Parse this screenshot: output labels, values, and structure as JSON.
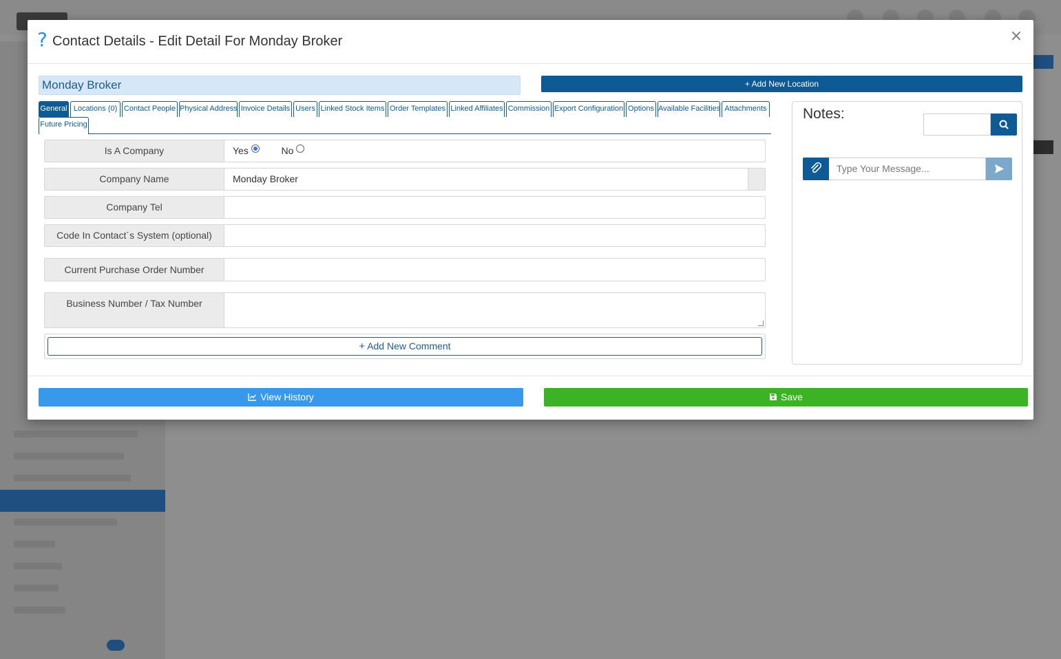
{
  "modal": {
    "title": "Contact Details - Edit Detail For Monday Broker",
    "help_icon": "?",
    "close_icon": "×"
  },
  "contact_name": "Monday Broker",
  "add_location_label": "+ Add New Location",
  "tabs": [
    {
      "label": "General",
      "active": true
    },
    {
      "label": "Locations (0)"
    },
    {
      "label": "Contact People"
    },
    {
      "label": "Physical Address"
    },
    {
      "label": "Invoice Details"
    },
    {
      "label": "Users"
    },
    {
      "label": "Linked Stock Items"
    },
    {
      "label": "Order Templates"
    },
    {
      "label": "Linked Affiliates"
    },
    {
      "label": "Commission"
    },
    {
      "label": "Export Configuration"
    },
    {
      "label": "Options"
    },
    {
      "label": "Available Facilities"
    },
    {
      "label": "Attachments"
    },
    {
      "label": "Future Pricing"
    }
  ],
  "form": {
    "is_company": {
      "label": "Is A Company",
      "yes": "Yes",
      "no": "No",
      "selected": "Yes"
    },
    "company_name": {
      "label": "Company Name",
      "value": "Monday Broker"
    },
    "company_tel": {
      "label": "Company Tel",
      "value": ""
    },
    "code": {
      "label": "Code In Contact´s System (optional)",
      "value": ""
    },
    "po_number": {
      "label": "Current Purchase Order Number",
      "value": ""
    },
    "business_number": {
      "label": "Business Number / Tax Number",
      "value": ""
    }
  },
  "add_comment_label": "Add New Comment",
  "notes": {
    "title": "Notes:",
    "search_value": "",
    "message_placeholder": "Type Your Message..."
  },
  "footer": {
    "history_label": "View History",
    "save_label": "Save"
  },
  "colors": {
    "primary": "#0d5a94",
    "history": "#3798ec",
    "save": "#3bb324"
  }
}
